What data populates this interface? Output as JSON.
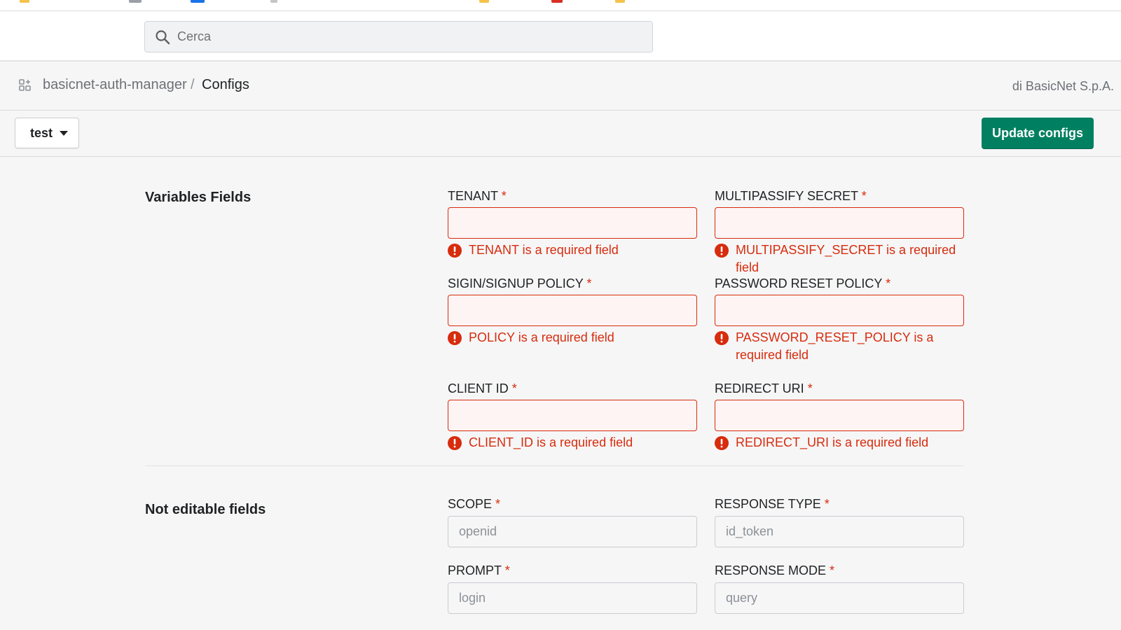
{
  "search": {
    "placeholder": "Cerca"
  },
  "breadcrumb": {
    "app": "basicnet-auth-manager",
    "separator": "/",
    "page": "Configs"
  },
  "owner": "di BasicNet S.p.A.",
  "env_select": {
    "selected": "test"
  },
  "update_button": "Update configs",
  "sections": {
    "variables": {
      "title": "Variables Fields",
      "fields": [
        {
          "label": "TENANT",
          "required": "*",
          "value": "",
          "error": "TENANT is a required field"
        },
        {
          "label": "MULTIPASSIFY SECRET",
          "required": "*",
          "value": "",
          "error": "MULTIPASSIFY_SECRET is a required field"
        },
        {
          "label": "SIGIN/SIGNUP POLICY",
          "required": "*",
          "value": "",
          "error": "POLICY is a required field"
        },
        {
          "label": "PASSWORD RESET POLICY",
          "required": "*",
          "value": "",
          "error": "PASSWORD_RESET_POLICY is a required field"
        },
        {
          "label": "CLIENT ID",
          "required": "*",
          "value": "",
          "error": "CLIENT_ID is a required field"
        },
        {
          "label": "REDIRECT URI",
          "required": "*",
          "value": "",
          "error": "REDIRECT_URI is a required field"
        }
      ]
    },
    "not_editable": {
      "title": "Not editable fields",
      "fields": [
        {
          "label": "SCOPE",
          "required": "*",
          "value": "openid"
        },
        {
          "label": "RESPONSE TYPE",
          "required": "*",
          "value": "id_token"
        },
        {
          "label": "PROMPT",
          "required": "*",
          "value": "login"
        },
        {
          "label": "RESPONSE MODE",
          "required": "*",
          "value": "query"
        }
      ]
    }
  },
  "colors": {
    "primary": "#008060",
    "critical": "#d72c0d",
    "error_bg": "#fff4f4"
  },
  "icons": {
    "search": "search-icon",
    "apps": "apps-icon",
    "dropdown": "caret-down-icon",
    "error": "alert-circle-icon"
  }
}
